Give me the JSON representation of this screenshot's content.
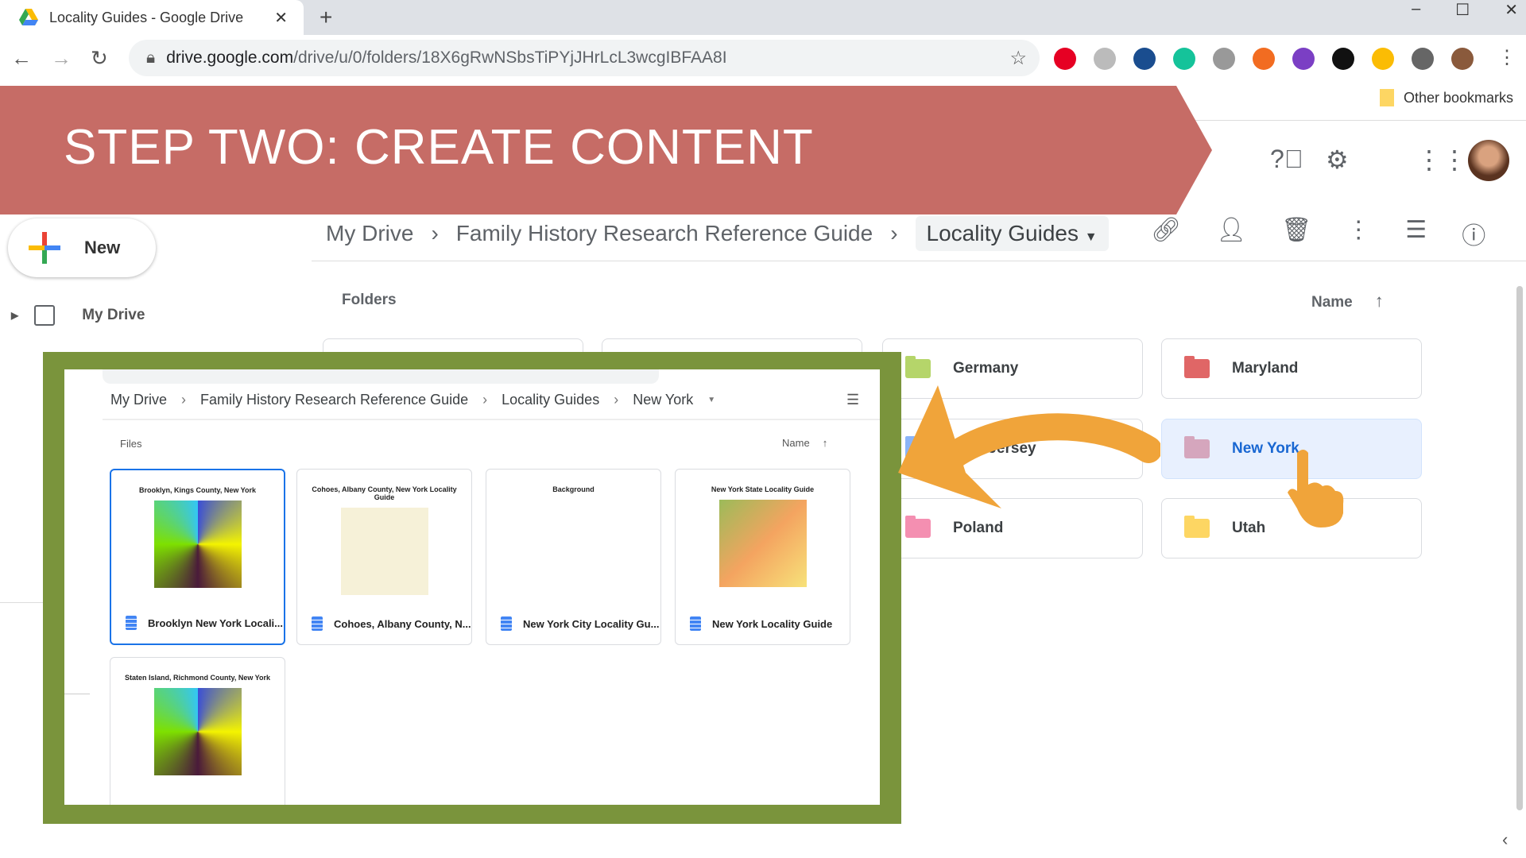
{
  "browser": {
    "tab_title": "Locality Guides - Google Drive",
    "url_host": "drive.google.com",
    "url_path": "/drive/u/0/folders/18X6gRwNSbsTiPYjJHrLcL3wcgIBFAA8I",
    "other_bookmarks": "Other bookmarks",
    "extensions": [
      {
        "name": "pinterest-icon",
        "color": "#e60023"
      },
      {
        "name": "extension-r-icon",
        "color": "#bbbbbb"
      },
      {
        "name": "extension-globe-icon",
        "color": "#1a4d8f"
      },
      {
        "name": "grammarly-icon",
        "color": "#15c39a"
      },
      {
        "name": "power-icon",
        "color": "#999999"
      },
      {
        "name": "honey-icon",
        "color": "#f26c21"
      },
      {
        "name": "onenote-icon",
        "color": "#7b3fc4"
      },
      {
        "name": "extension-9-icon",
        "color": "#111111"
      },
      {
        "name": "drive-icon",
        "color": "#fbbc04"
      },
      {
        "name": "puzzle-icon",
        "color": "#666666"
      },
      {
        "name": "profile-avatar-icon",
        "color": "#8a5a3c"
      }
    ]
  },
  "banner": {
    "text": "STEP TWO:  CREATE CONTENT",
    "color": "#c66c66"
  },
  "drive": {
    "new_label": "New",
    "sidebar": {
      "my_drive": "My Drive"
    },
    "breadcrumb": [
      "My Drive",
      "Family History Research Reference Guide",
      "Locality Guides"
    ],
    "folders_label": "Folders",
    "sort_label": "Name",
    "folders": [
      {
        "name": "Germany",
        "color": "#b5d56a"
      },
      {
        "name": "Maryland",
        "color": "#e06666"
      },
      {
        "name": "New Jersey",
        "color": "#8ab4f8"
      },
      {
        "name": "New York",
        "color": "#d5a6bd",
        "selected": true
      },
      {
        "name": "Poland",
        "color": "#f48fb1"
      },
      {
        "name": "Utah",
        "color": "#fdd663"
      }
    ]
  },
  "inset": {
    "breadcrumb": [
      "My Drive",
      "Family History Research Reference Guide",
      "Locality Guides",
      "New York"
    ],
    "files_label": "Files",
    "sort_label": "Name",
    "files": [
      {
        "name": "Brooklyn New York Locali...",
        "preview_title": "Brooklyn, Kings County, New York",
        "selected": true
      },
      {
        "name": "Cohoes, Albany County, N...",
        "preview_title": "Cohoes, Albany County, New York Locality Guide"
      },
      {
        "name": "New York City Locality Gu...",
        "preview_title": "Background"
      },
      {
        "name": "New York Locality Guide",
        "preview_title": "New York State Locality Guide"
      },
      {
        "name": "",
        "preview_title": "Staten Island, Richmond County, New York"
      }
    ]
  },
  "accent": {
    "green_frame": "#7a943c",
    "arrow": "#f0a43a"
  }
}
